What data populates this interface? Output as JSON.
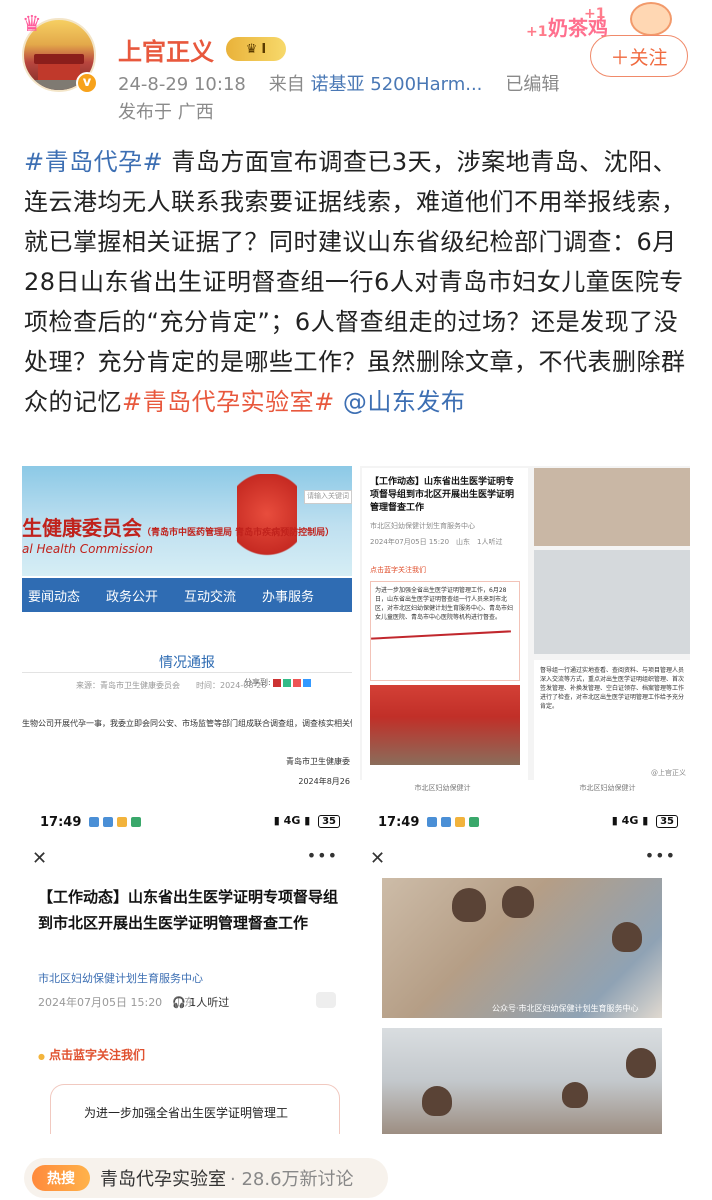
{
  "user": {
    "name": "上官正义",
    "level_badge": "I",
    "timestamp": "24-8-29 10:18",
    "source_prefix": "来自",
    "device": "诺基亚 5200Harm...",
    "edited": "已编辑",
    "location": "发布于 广西"
  },
  "sticker": {
    "text": "奶茶鸡",
    "plus": "+1"
  },
  "follow_button": "＋关注",
  "post": {
    "tag1": "#青岛代孕#",
    "body": "青岛方面宣布调查已3天，涉案地青岛、沈阳、连云港均无人联系我索要证据线索，难道他们不用举报线索，就已掌握相关证据了？同时建议山东省级纪检部门调查：6月28日山东省出生证明督查组一行6人对青岛市妇女儿童医院专项检查后的“充分肯定”；6人督查组走的过场？还是发现了没处理？充分肯定的是哪些工作？虽然删除文章，不代表删除群众的记忆",
    "tag2": "#青岛代孕实验室#",
    "mention": "@山东发布"
  },
  "image1": {
    "header_title": "生健康委员会",
    "header_sub": "（青岛市中医药管理局 青岛市疾病预防控制局）",
    "header_en": "al Health Commission",
    "search_placeholder": "请输入关键词",
    "nav": [
      "要闻动态",
      "政务公开",
      "互动交流",
      "办事服务"
    ],
    "notice_title": "情况通报",
    "source": "来源：青岛市卫生健康委员会　　时间：2024-08-26",
    "share": "分享到:",
    "paragraph": "生物公司开展代孕一事，我委立即会同公安、市场监管等部门组成联合调查组，调查核实相关情况。",
    "signature": "青岛市卫生健康委",
    "date": "2024年8月26"
  },
  "image2": {
    "heading": "【工作动态】山东省出生医学证明专项督导组到市北区开展出生医学证明管理督查工作",
    "org": "市北区妇幼保健计划生育服务中心",
    "time": "2024年07月05日 15:20　山东　1人听过",
    "follow": "点击蓝字关注我们",
    "box_text": "为进一步加强全省出生医学证明管理工作，6月28日，山东省出生医学证明督查组一行人员来到市北区，对市北区妇幼保健计划生育服务中心、青岛市妇女儿童医院、青岛市中心医院等机构进行督查。",
    "right_text": "督导组一行通过实地查看、查阅资料、与项目管理人员深入交流等方式，重点对出生医学证明组织管理、首次签发管理、补换发管理、空白证领存、档案管理等工作进行了检查，对市北区出生医学证明管理工作给予充分肯定。",
    "bottom_left": "市北区妇幼保健计",
    "bottom_right": "市北区妇幼保健计",
    "watermark": "@上官正义"
  },
  "image3": {
    "clock": "17:49",
    "battery": "35",
    "title": "【工作动态】山东省出生医学证明专项督导组到市北区开展出生医学证明管理督查工作",
    "org": "市北区妇幼保健计划生育服务中心",
    "time": "2024年07月05日 15:20　山东",
    "listen": "🎧 1人听过",
    "follow": "点击蓝字关注我们",
    "content": "为进一步加强全省出生医学证明管理工"
  },
  "image4": {
    "clock": "17:49",
    "battery": "35",
    "watermark": "公众号·市北区妇幼保健计划生育服务中心"
  },
  "hot": {
    "badge": "热搜",
    "topic": "青岛代孕实验室",
    "count": "· 28.6万新讨论"
  }
}
